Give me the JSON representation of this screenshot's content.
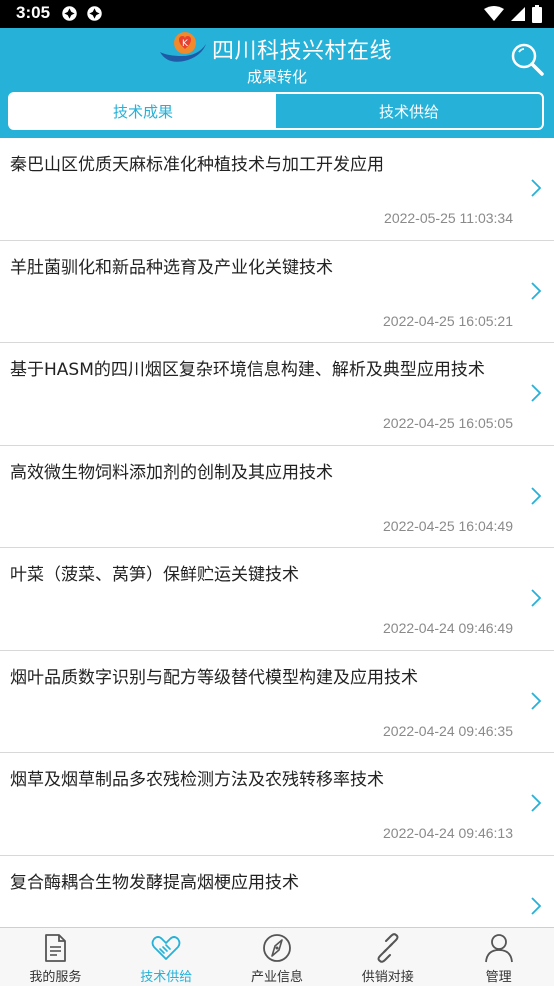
{
  "status_bar": {
    "time": "3:05",
    "icons": [
      "app-notification-icon",
      "app-notification-icon",
      "wifi-icon",
      "signal-icon",
      "battery-icon"
    ]
  },
  "header": {
    "title": "四川科技兴村在线",
    "subtitle": "成果转化",
    "search_icon": "search-icon",
    "tabs": [
      {
        "label": "技术成果",
        "active": false
      },
      {
        "label": "技术供给",
        "active": true
      }
    ]
  },
  "list": {
    "items": [
      {
        "title": "秦巴山区优质天麻标准化种植技术与加工开发应用",
        "time": "2022-05-25 11:03:34"
      },
      {
        "title": "羊肚菌驯化和新品种选育及产业化关键技术",
        "time": "2022-04-25 16:05:21"
      },
      {
        "title": "基于HASM的四川烟区复杂环境信息构建、解析及典型应用技术",
        "time": "2022-04-25 16:05:05"
      },
      {
        "title": "高效微生物饲料添加剂的创制及其应用技术",
        "time": "2022-04-25 16:04:49"
      },
      {
        "title": "叶菜（菠菜、莴笋）保鲜贮运关键技术",
        "time": "2022-04-24 09:46:49"
      },
      {
        "title": "烟叶品质数字识别与配方等级替代模型构建及应用技术",
        "time": "2022-04-24 09:46:35"
      },
      {
        "title": "烟草及烟草制品多农残检测方法及农残转移率技术",
        "time": "2022-04-24 09:46:13"
      },
      {
        "title": "复合酶耦合生物发酵提高烟梗应用技术",
        "time": ""
      }
    ]
  },
  "bottom_nav": {
    "items": [
      {
        "label": "我的服务",
        "icon": "document-icon",
        "active": false
      },
      {
        "label": "技术供给",
        "icon": "handshake-icon",
        "active": true
      },
      {
        "label": "产业信息",
        "icon": "compass-icon",
        "active": false
      },
      {
        "label": "供销对接",
        "icon": "link-icon",
        "active": false
      },
      {
        "label": "管理",
        "icon": "person-icon",
        "active": false
      }
    ]
  },
  "colors": {
    "primary": "#26b1d8",
    "text": "#222222",
    "muted": "#8a8a8a"
  }
}
